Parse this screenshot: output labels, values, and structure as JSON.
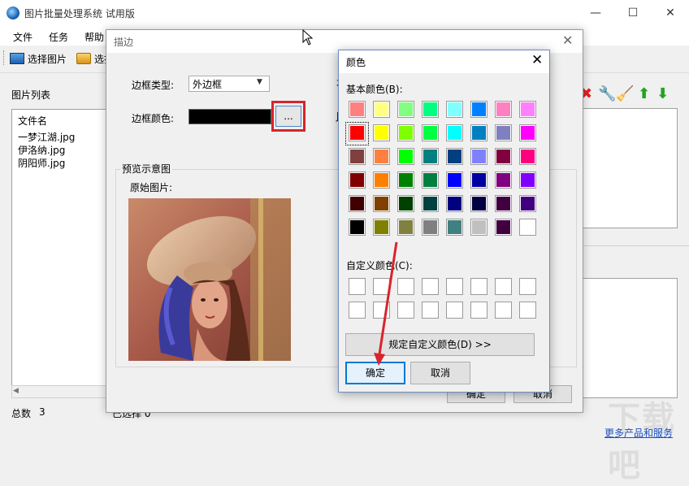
{
  "main": {
    "title": "图片批量处理系统 试用版",
    "menu": [
      "文件",
      "任务",
      "帮助"
    ],
    "toolbar": {
      "select_image": "选择图片",
      "select_folder_partial": "选择"
    },
    "file_list_title": "图片列表",
    "file_list_header": "文件名",
    "files": [
      "一梦江湖.jpg",
      "伊洛纳.jpg",
      "阴阳师.jpg"
    ],
    "total_label": "总数",
    "total_value": "3",
    "selected_label_partial": "已选择 0",
    "more_link": "更多产品和服务",
    "window_controls": {
      "minimize": "—",
      "maximize": "☐",
      "close": "✕"
    },
    "toolbar_right_icons": [
      "delete-icon",
      "wrench-icon",
      "broom-icon",
      "up-arrow-icon",
      "down-arrow-icon"
    ]
  },
  "border_dialog": {
    "title": "描边",
    "border_type_label": "边框类型:",
    "border_type_value": "外边框",
    "border_color_label": "边框颜色:",
    "border_color_value": "#000000",
    "color_button_label": "...",
    "preview_group_label": "预览示意图",
    "original_image_label": "原始图片:",
    "ok_label": "确定",
    "cancel_label": "取消",
    "close_glyph": "✕"
  },
  "color_dialog": {
    "title": "颜色",
    "close_glyph": "✕",
    "basic_colors_label": "基本颜色(B):",
    "custom_colors_label": "自定义颜色(C):",
    "define_custom_label": "规定自定义颜色(D) >>",
    "ok_label": "确定",
    "cancel_label": "取消",
    "selected_index": 8,
    "basic_colors": [
      "#ff8080",
      "#ffff80",
      "#80ff80",
      "#00ff80",
      "#80ffff",
      "#0080ff",
      "#ff80c0",
      "#ff80ff",
      "#ff0000",
      "#ffff00",
      "#80ff00",
      "#00ff40",
      "#00ffff",
      "#0080c0",
      "#8080c0",
      "#ff00ff",
      "#804040",
      "#ff8040",
      "#00ff00",
      "#008080",
      "#004080",
      "#8080ff",
      "#800040",
      "#ff0080",
      "#800000",
      "#ff8000",
      "#008000",
      "#008040",
      "#0000ff",
      "#0000a0",
      "#800080",
      "#8000ff",
      "#400000",
      "#804000",
      "#004000",
      "#004040",
      "#000080",
      "#000040",
      "#400040",
      "#400080",
      "#000000",
      "#808000",
      "#808040",
      "#808080",
      "#408080",
      "#c0c0c0",
      "#400040",
      "#ffffff"
    ],
    "custom_colors": [
      "#ffffff",
      "#ffffff",
      "#ffffff",
      "#ffffff",
      "#ffffff",
      "#ffffff",
      "#ffffff",
      "#ffffff",
      "#ffffff",
      "#ffffff",
      "#ffffff",
      "#ffffff",
      "#ffffff",
      "#ffffff",
      "#ffffff",
      "#ffffff"
    ]
  },
  "colors": {
    "highlight_red": "#d8242c",
    "annotation_arrow": "#d8242c",
    "link_blue": "#1b4fbf",
    "dialog_accent": "#0078d7"
  }
}
